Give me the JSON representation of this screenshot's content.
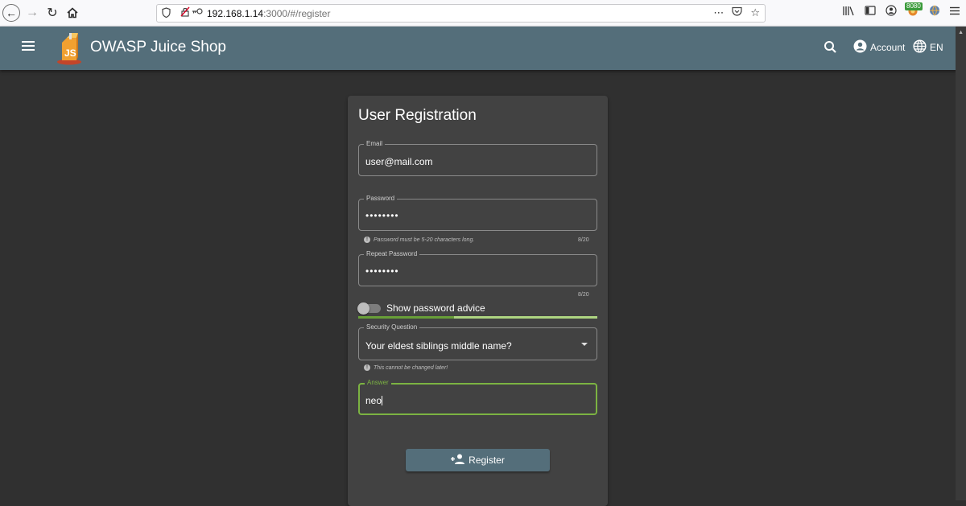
{
  "browser": {
    "url_host": "192.168.1.14",
    "url_path": ":3000/#/register",
    "proxy_badge": "8080"
  },
  "app": {
    "title": "OWASP Juice Shop",
    "account_label": "Account",
    "language_label": "EN",
    "toolbar_color": "#546e7a",
    "background_color": "#303030",
    "card_color": "#424242"
  },
  "form": {
    "title": "User Registration",
    "email": {
      "label": "Email",
      "value": "user@mail.com"
    },
    "password": {
      "label": "Password",
      "value": "••••••••",
      "hint": "Password must be 5-20 characters long.",
      "counter": "8/20"
    },
    "repeat_password": {
      "label": "Repeat Password",
      "value": "••••••••",
      "counter": "8/20"
    },
    "password_advice": {
      "label": "Show password advice",
      "enabled": false,
      "strength_fraction": 0.4
    },
    "security_question": {
      "label": "Security Question",
      "value": "Your eldest siblings middle name?",
      "hint": "This cannot be changed later!"
    },
    "answer": {
      "label": "Answer",
      "value": "neo"
    },
    "register_label": "Register"
  }
}
